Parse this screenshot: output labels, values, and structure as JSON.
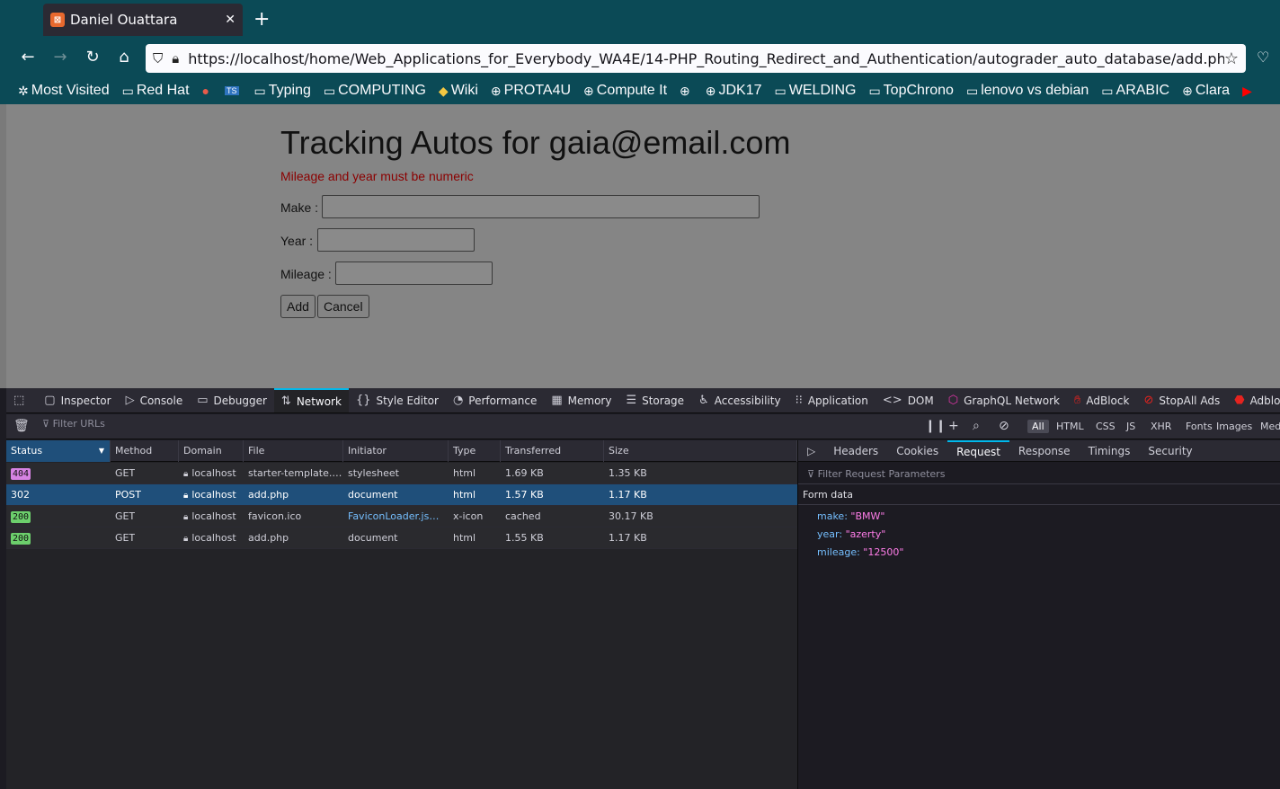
{
  "browser": {
    "tab_title": "Daniel Ouattara",
    "url": "https://localhost/home/Web_Applications_for_Everybody_WA4E/14-PHP_Routing_Redirect_and_Authentication/autograder_auto_database/add.php",
    "bookmarks": [
      "Most Visited",
      "Red Hat",
      "Typing",
      "COMPUTING",
      "Wiki",
      "PROTA4U",
      "Compute It",
      "JDK17",
      "WELDING",
      "TopChrono",
      "lenovo vs debian",
      "ARABIC",
      "Clara"
    ]
  },
  "page": {
    "title": "Tracking Autos for gaia@email.com",
    "error": "Mileage and year must be numeric",
    "make_label": "Make :",
    "year_label": "Year :",
    "mileage_label": "Mileage :",
    "add_button": "Add",
    "cancel_button": "Cancel"
  },
  "devtools": {
    "tabs": [
      "Inspector",
      "Console",
      "Debugger",
      "Network",
      "Style Editor",
      "Performance",
      "Memory",
      "Storage",
      "Accessibility",
      "Application",
      "DOM",
      "GraphQL Network",
      "AdBlock",
      "StopAll Ads",
      "Adblock Pl"
    ],
    "active_tab": "Network",
    "filter_placeholder": "Filter URLs",
    "type_filters": [
      "All",
      "HTML",
      "CSS",
      "JS",
      "XHR",
      "Fonts",
      "Images",
      "Med"
    ],
    "columns": [
      "Status",
      "Method",
      "Domain",
      "File",
      "Initiator",
      "Type",
      "Transferred",
      "Size"
    ],
    "rows": [
      {
        "status": "404",
        "method": "GET",
        "domain": "localhost",
        "file": "starter-template.css",
        "initiator": "stylesheet",
        "type": "html",
        "transferred": "1.69 KB",
        "size": "1.35 KB"
      },
      {
        "status": "302",
        "method": "POST",
        "domain": "localhost",
        "file": "add.php",
        "initiator": "document",
        "type": "html",
        "transferred": "1.57 KB",
        "size": "1.17 KB"
      },
      {
        "status": "200",
        "method": "GET",
        "domain": "localhost",
        "file": "favicon.ico",
        "initiator": "FaviconLoader.jsm:…",
        "type": "x-icon",
        "transferred": "cached",
        "size": "30.17 KB"
      },
      {
        "status": "200",
        "method": "GET",
        "domain": "localhost",
        "file": "add.php",
        "initiator": "document",
        "type": "html",
        "transferred": "1.55 KB",
        "size": "1.17 KB"
      }
    ],
    "side_tabs": [
      "Headers",
      "Cookies",
      "Request",
      "Response",
      "Timings",
      "Security"
    ],
    "side_active": "Request",
    "param_filter": "Filter Request Parameters",
    "form_data_title": "Form data",
    "params": [
      {
        "key": "make:",
        "value": "\"BMW\""
      },
      {
        "key": "year:",
        "value": "\"azerty\""
      },
      {
        "key": "mileage:",
        "value": "\"12500\""
      }
    ]
  },
  "colors": {
    "chrome_bg": "#0b4a56",
    "accent": "#00b8eb",
    "badge_404": "#d683e3",
    "badge_200": "#6ccf6c",
    "error_text": "#8b0000"
  }
}
